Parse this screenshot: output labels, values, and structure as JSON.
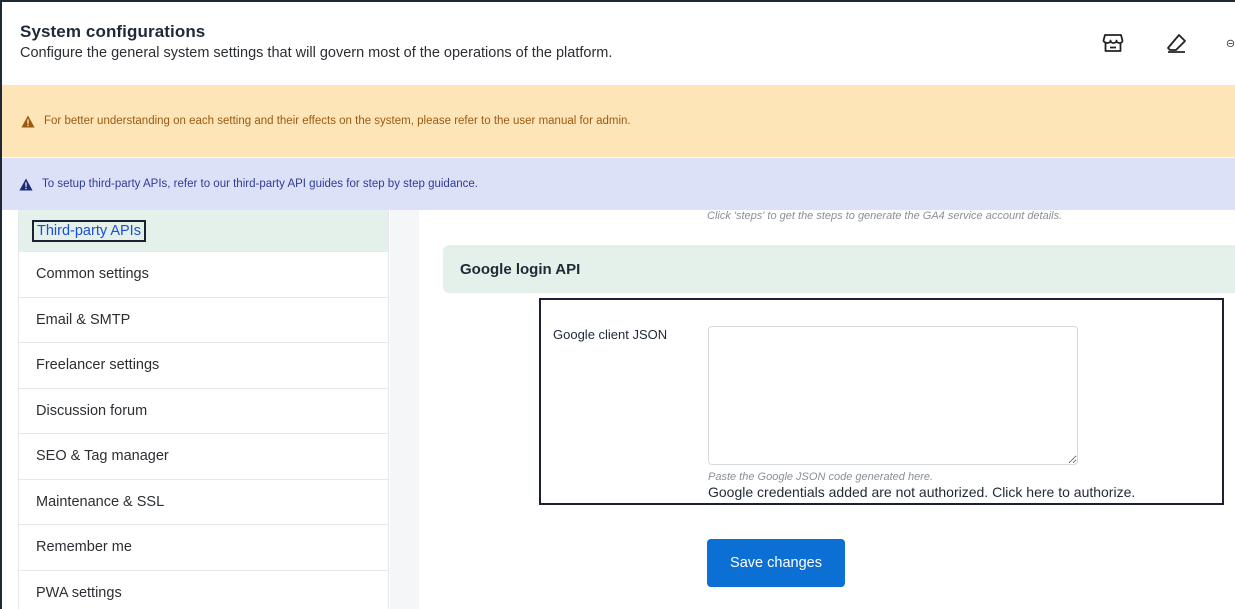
{
  "header": {
    "title": "System configurations",
    "subtitle": "Configure the general system settings that will govern most of the operations of the platform."
  },
  "header_icons": [
    "storefront-icon",
    "eraser-icon",
    "partial-icon"
  ],
  "alerts": {
    "warning": "For better understanding on each setting and their effects on the system, please refer to the user manual for admin.",
    "info": "To setup third-party APIs, refer to our third-party API guides for step by step guidance."
  },
  "sidebar": {
    "items": [
      {
        "label": "Third-party APIs",
        "active": true
      },
      {
        "label": "Common settings"
      },
      {
        "label": "Email & SMTP"
      },
      {
        "label": "Freelancer settings"
      },
      {
        "label": "Discussion forum"
      },
      {
        "label": "SEO & Tag manager"
      },
      {
        "label": "Maintenance & SSL"
      },
      {
        "label": "Remember me"
      },
      {
        "label": "PWA settings"
      }
    ]
  },
  "content": {
    "top_help": "Click 'steps' to get the steps to generate the GA4 service account details.",
    "section_title": "Google login API",
    "field": {
      "label": "Google client JSON",
      "value": "",
      "help": "Paste the Google JSON code generated here.",
      "auth_note": "Google credentials added are not authorized. Click here to authorize."
    },
    "save_label": "Save changes"
  },
  "colors": {
    "warning_bg": "#fde5b8",
    "info_bg": "#dce1f8",
    "active_bg": "#e3f1ea",
    "primary": "#0b6fd3"
  }
}
